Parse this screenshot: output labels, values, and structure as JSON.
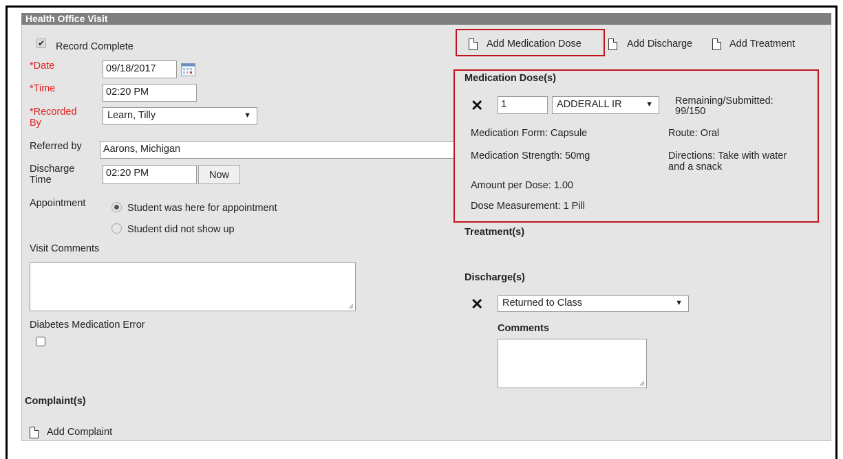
{
  "panel": {
    "title": "Health Office Visit"
  },
  "record_complete": {
    "label": "Record Complete",
    "checked": true
  },
  "date": {
    "label": "*Date",
    "value": "09/18/2017"
  },
  "time": {
    "label": "*Time",
    "value": "02:20 PM"
  },
  "recorded_by": {
    "label_line1": "*Recorded",
    "label_line2": "By",
    "value": "Learn, Tilly"
  },
  "referred_by": {
    "label": "Referred by",
    "value": "Aarons, Michigan"
  },
  "discharge_time": {
    "label_line1": "Discharge",
    "label_line2": "Time",
    "value": "02:20 PM",
    "now_button": "Now"
  },
  "appointment": {
    "label": "Appointment",
    "options": [
      "Student was here for appointment",
      "Student did not show up"
    ],
    "selected": "Student was here for appointment"
  },
  "visit_comments": {
    "label": "Visit Comments",
    "value": ""
  },
  "diabetes_error": {
    "label": "Diabetes Medication Error",
    "checked": false
  },
  "complaints": {
    "heading": "Complaint(s)",
    "add_label": "Add Complaint"
  },
  "actions": {
    "add_medication_dose": "Add Medication Dose",
    "add_discharge": "Add Discharge",
    "add_treatment": "Add Treatment"
  },
  "medication": {
    "heading": "Medication Dose(s)",
    "quantity": "1",
    "drug": "ADDERALL IR",
    "remaining_line1": "Remaining/Submitted:",
    "remaining_line2": "99/150",
    "form": "Medication Form: Capsule",
    "route": "Route: Oral",
    "strength": "Medication Strength: 50mg",
    "directions_line1": "Directions: Take with water",
    "directions_line2": "and a snack",
    "amount": "Amount per Dose: 1.00",
    "measurement": "Dose Measurement: 1 Pill"
  },
  "treatments": {
    "heading": "Treatment(s)"
  },
  "discharges": {
    "heading": "Discharge(s)",
    "value": "Returned to Class",
    "comments_label": "Comments",
    "comments_value": ""
  },
  "colors": {
    "required": "#e02020",
    "highlight": "#c0131b",
    "title_bar": "#7f7f7f",
    "panel_bg": "#e5e5e5"
  }
}
